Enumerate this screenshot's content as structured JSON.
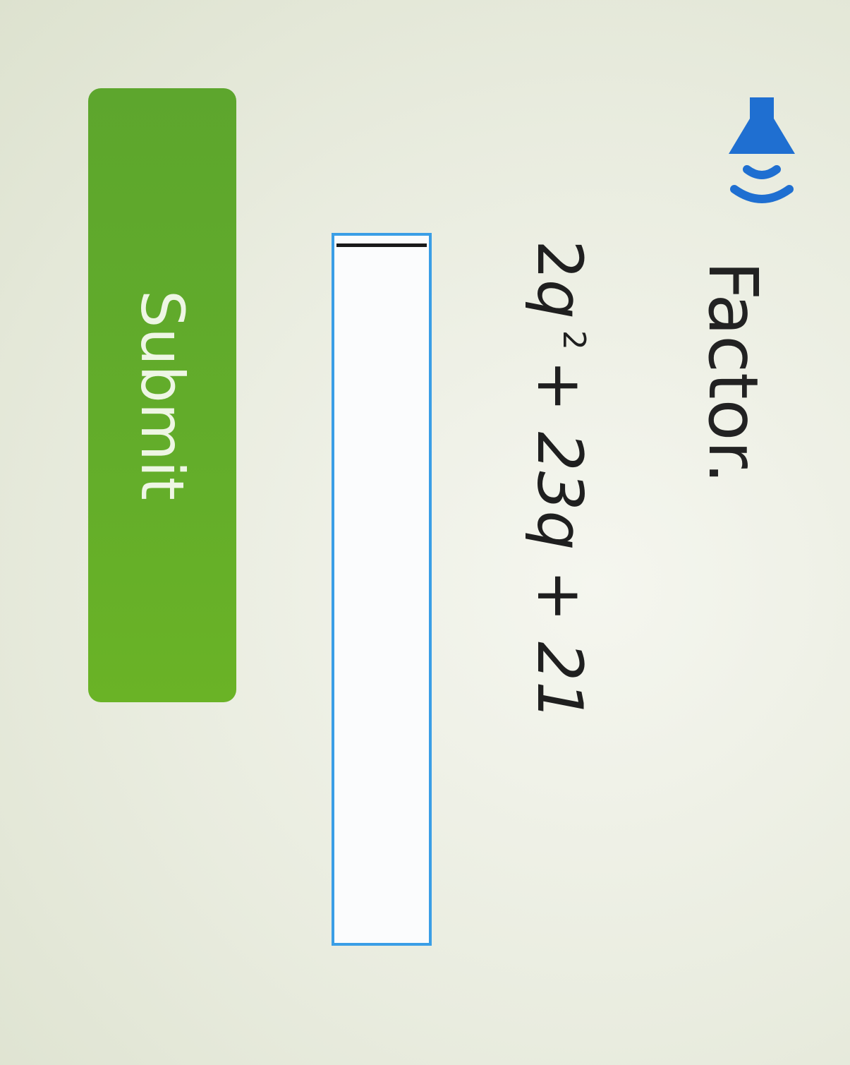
{
  "question": {
    "instruction": "Factor.",
    "expression": {
      "coefficient": "2",
      "variable": "q",
      "exponent": "2",
      "rest": "+ 23q + 21"
    }
  },
  "answer": {
    "value": ""
  },
  "actions": {
    "submit_label": "Submit"
  },
  "icons": {
    "audio": "speaker-icon"
  },
  "colors": {
    "submit_button": "#63ad2a",
    "input_border": "#3a9ee6",
    "speaker_icon": "#1f6fd1"
  }
}
